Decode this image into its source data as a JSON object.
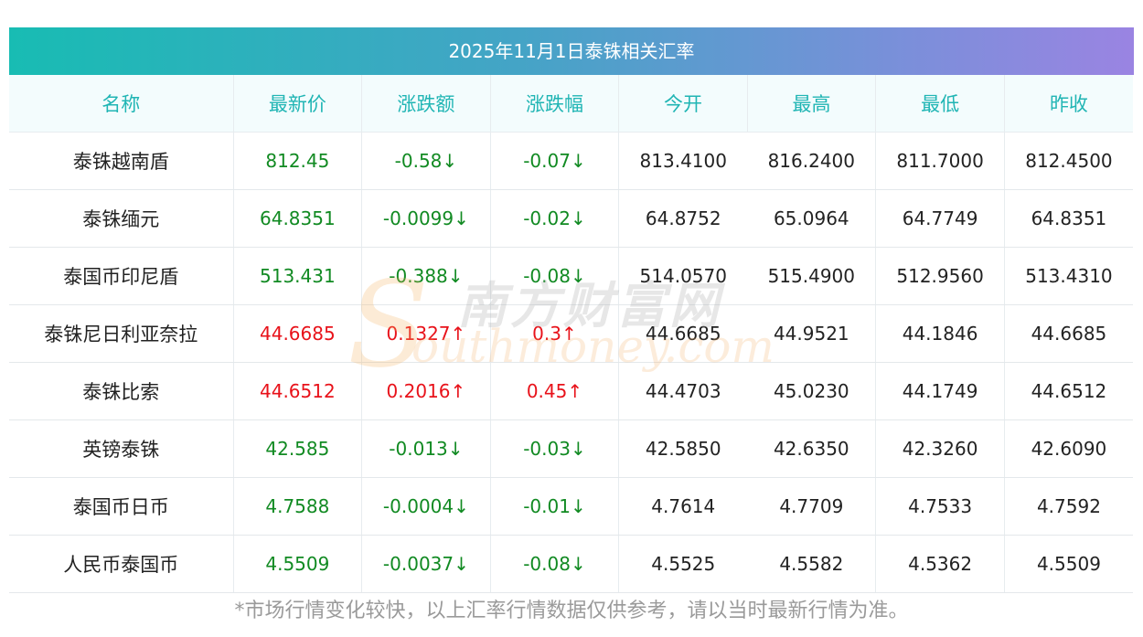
{
  "title": "2025年11月1日泰铢相关汇率",
  "columns": [
    "名称",
    "最新价",
    "涨跌额",
    "涨跌幅",
    "今开",
    "最高",
    "最低",
    "昨收"
  ],
  "rows": [
    {
      "name": "泰铢越南盾",
      "latest": "812.45",
      "change": "-0.58↓",
      "pct": "-0.07↓",
      "open": "813.4100",
      "high": "816.2400",
      "low": "811.7000",
      "prev": "812.4500",
      "dir": "down"
    },
    {
      "name": "泰铢缅元",
      "latest": "64.8351",
      "change": "-0.0099↓",
      "pct": "-0.02↓",
      "open": "64.8752",
      "high": "65.0964",
      "low": "64.7749",
      "prev": "64.8351",
      "dir": "down"
    },
    {
      "name": "泰国币印尼盾",
      "latest": "513.431",
      "change": "-0.388↓",
      "pct": "-0.08↓",
      "open": "514.0570",
      "high": "515.4900",
      "low": "512.9560",
      "prev": "513.4310",
      "dir": "down"
    },
    {
      "name": "泰铢尼日利亚奈拉",
      "latest": "44.6685",
      "change": "0.1327↑",
      "pct": "0.3↑",
      "open": "44.6685",
      "high": "44.9521",
      "low": "44.1846",
      "prev": "44.6685",
      "dir": "up"
    },
    {
      "name": "泰铢比索",
      "latest": "44.6512",
      "change": "0.2016↑",
      "pct": "0.45↑",
      "open": "44.4703",
      "high": "45.0230",
      "low": "44.1749",
      "prev": "44.6512",
      "dir": "up"
    },
    {
      "name": "英镑泰铢",
      "latest": "42.585",
      "change": "-0.013↓",
      "pct": "-0.03↓",
      "open": "42.5850",
      "high": "42.6350",
      "low": "42.3260",
      "prev": "42.6090",
      "dir": "down"
    },
    {
      "name": "泰国币日币",
      "latest": "4.7588",
      "change": "-0.0004↓",
      "pct": "-0.01↓",
      "open": "4.7614",
      "high": "4.7709",
      "low": "4.7533",
      "prev": "4.7592",
      "dir": "down"
    },
    {
      "name": "人民币泰国币",
      "latest": "4.5509",
      "change": "-0.0037↓",
      "pct": "-0.08↓",
      "open": "4.5525",
      "high": "4.5582",
      "low": "4.5362",
      "prev": "4.5509",
      "dir": "down"
    }
  ],
  "note": "*市场行情变化较快，以上汇率行情数据仅供参考，请以当时最新行情为准。",
  "watermark": {
    "cn": "南方财富网",
    "en": "outhmoney.com",
    "s": "S"
  },
  "colors": {
    "up": "#e8121a",
    "down": "#118a22",
    "header_text": "#20b5b4",
    "title_gradient_start": "#18bcb3",
    "title_gradient_end": "#9a84e2"
  }
}
